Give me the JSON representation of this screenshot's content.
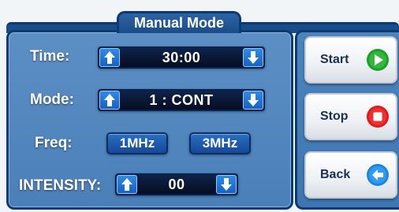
{
  "header": {
    "title": "Manual Mode"
  },
  "rows": {
    "time": {
      "label": "Time:",
      "value": "30:00"
    },
    "mode": {
      "label": "Mode:",
      "value": "1 : CONT"
    },
    "freq": {
      "label": "Freq:",
      "options": [
        "1MHz",
        "3MHz"
      ]
    },
    "intensity": {
      "label": "INTENSITY:",
      "value": "00"
    }
  },
  "actions": {
    "start": {
      "label": "Start",
      "icon": "play-icon",
      "color": "#1f9e2a"
    },
    "stop": {
      "label": "Stop",
      "icon": "stop-icon",
      "color": "#e01b1b"
    },
    "back": {
      "label": "Back",
      "icon": "back-arrow-icon",
      "color": "#1a86e0"
    }
  },
  "icons": {
    "increase": "arrow-up-icon",
    "decrease": "arrow-down-icon"
  },
  "colors": {
    "panel": "#5488bf",
    "frame": "#0d3a73",
    "button": "#1463c4"
  }
}
